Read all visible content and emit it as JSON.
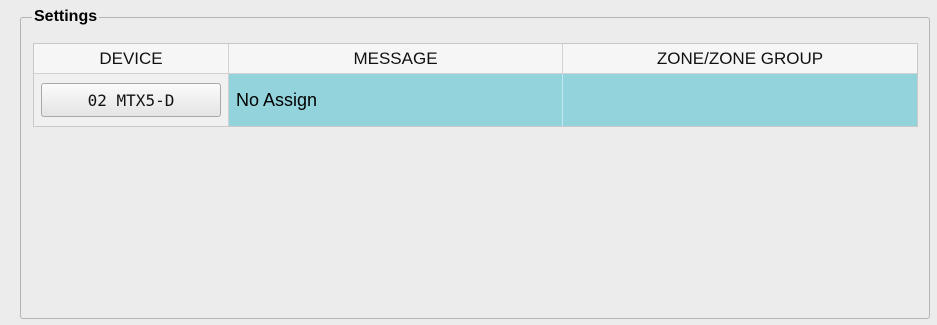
{
  "group": {
    "title": "Settings"
  },
  "table": {
    "columns": [
      "DEVICE",
      "MESSAGE",
      "ZONE/ZONE GROUP"
    ],
    "rows": [
      {
        "device": "02 MTX5-D",
        "message": "No Assign",
        "zone": ""
      }
    ]
  },
  "colors": {
    "selected_row": "#93d4dc",
    "background": "#ececec"
  }
}
